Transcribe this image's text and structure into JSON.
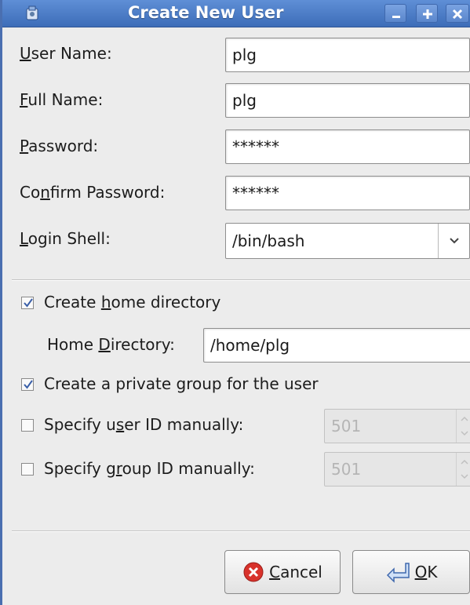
{
  "window": {
    "title": "Create New User"
  },
  "form": {
    "user_name": {
      "label_pre": "",
      "label_mnemonic": "U",
      "label_post": "ser Name:",
      "value": "plg"
    },
    "full_name": {
      "label_pre": "",
      "label_mnemonic": "F",
      "label_post": "ull Name:",
      "value": "plg"
    },
    "password": {
      "label_pre": "",
      "label_mnemonic": "P",
      "label_post": "assword:",
      "value": "******"
    },
    "confirm_password": {
      "label_pre": "Co",
      "label_mnemonic": "n",
      "label_post": "firm Password:",
      "value": "******"
    },
    "login_shell": {
      "label_pre": "",
      "label_mnemonic": "L",
      "label_post": "ogin Shell:",
      "value": "/bin/bash"
    }
  },
  "options": {
    "create_home": {
      "label_pre": "Create ",
      "label_mnemonic": "h",
      "label_post": "ome directory",
      "checked": true
    },
    "home_directory": {
      "label_pre": "Home ",
      "label_mnemonic": "D",
      "label_post": "irectory:",
      "value": "/home/plg"
    },
    "private_group": {
      "label": "Create a private group for the user",
      "checked": true
    },
    "specify_uid": {
      "label_pre": "Specify u",
      "label_mnemonic": "s",
      "label_post": "er ID manually:",
      "checked": false,
      "value": "501"
    },
    "specify_gid": {
      "label_pre": "Specify g",
      "label_mnemonic": "r",
      "label_post": "oup ID manually:",
      "checked": false,
      "value": "501"
    }
  },
  "buttons": {
    "cancel": {
      "label_mnemonic": "C",
      "label_post": "ancel",
      "icon": "cancel-icon"
    },
    "ok": {
      "label_mnemonic": "O",
      "label_post": "K",
      "icon": "ok-icon"
    }
  },
  "colors": {
    "titlebar": "#4a7cc7",
    "cancel_icon": "#d8322b"
  }
}
